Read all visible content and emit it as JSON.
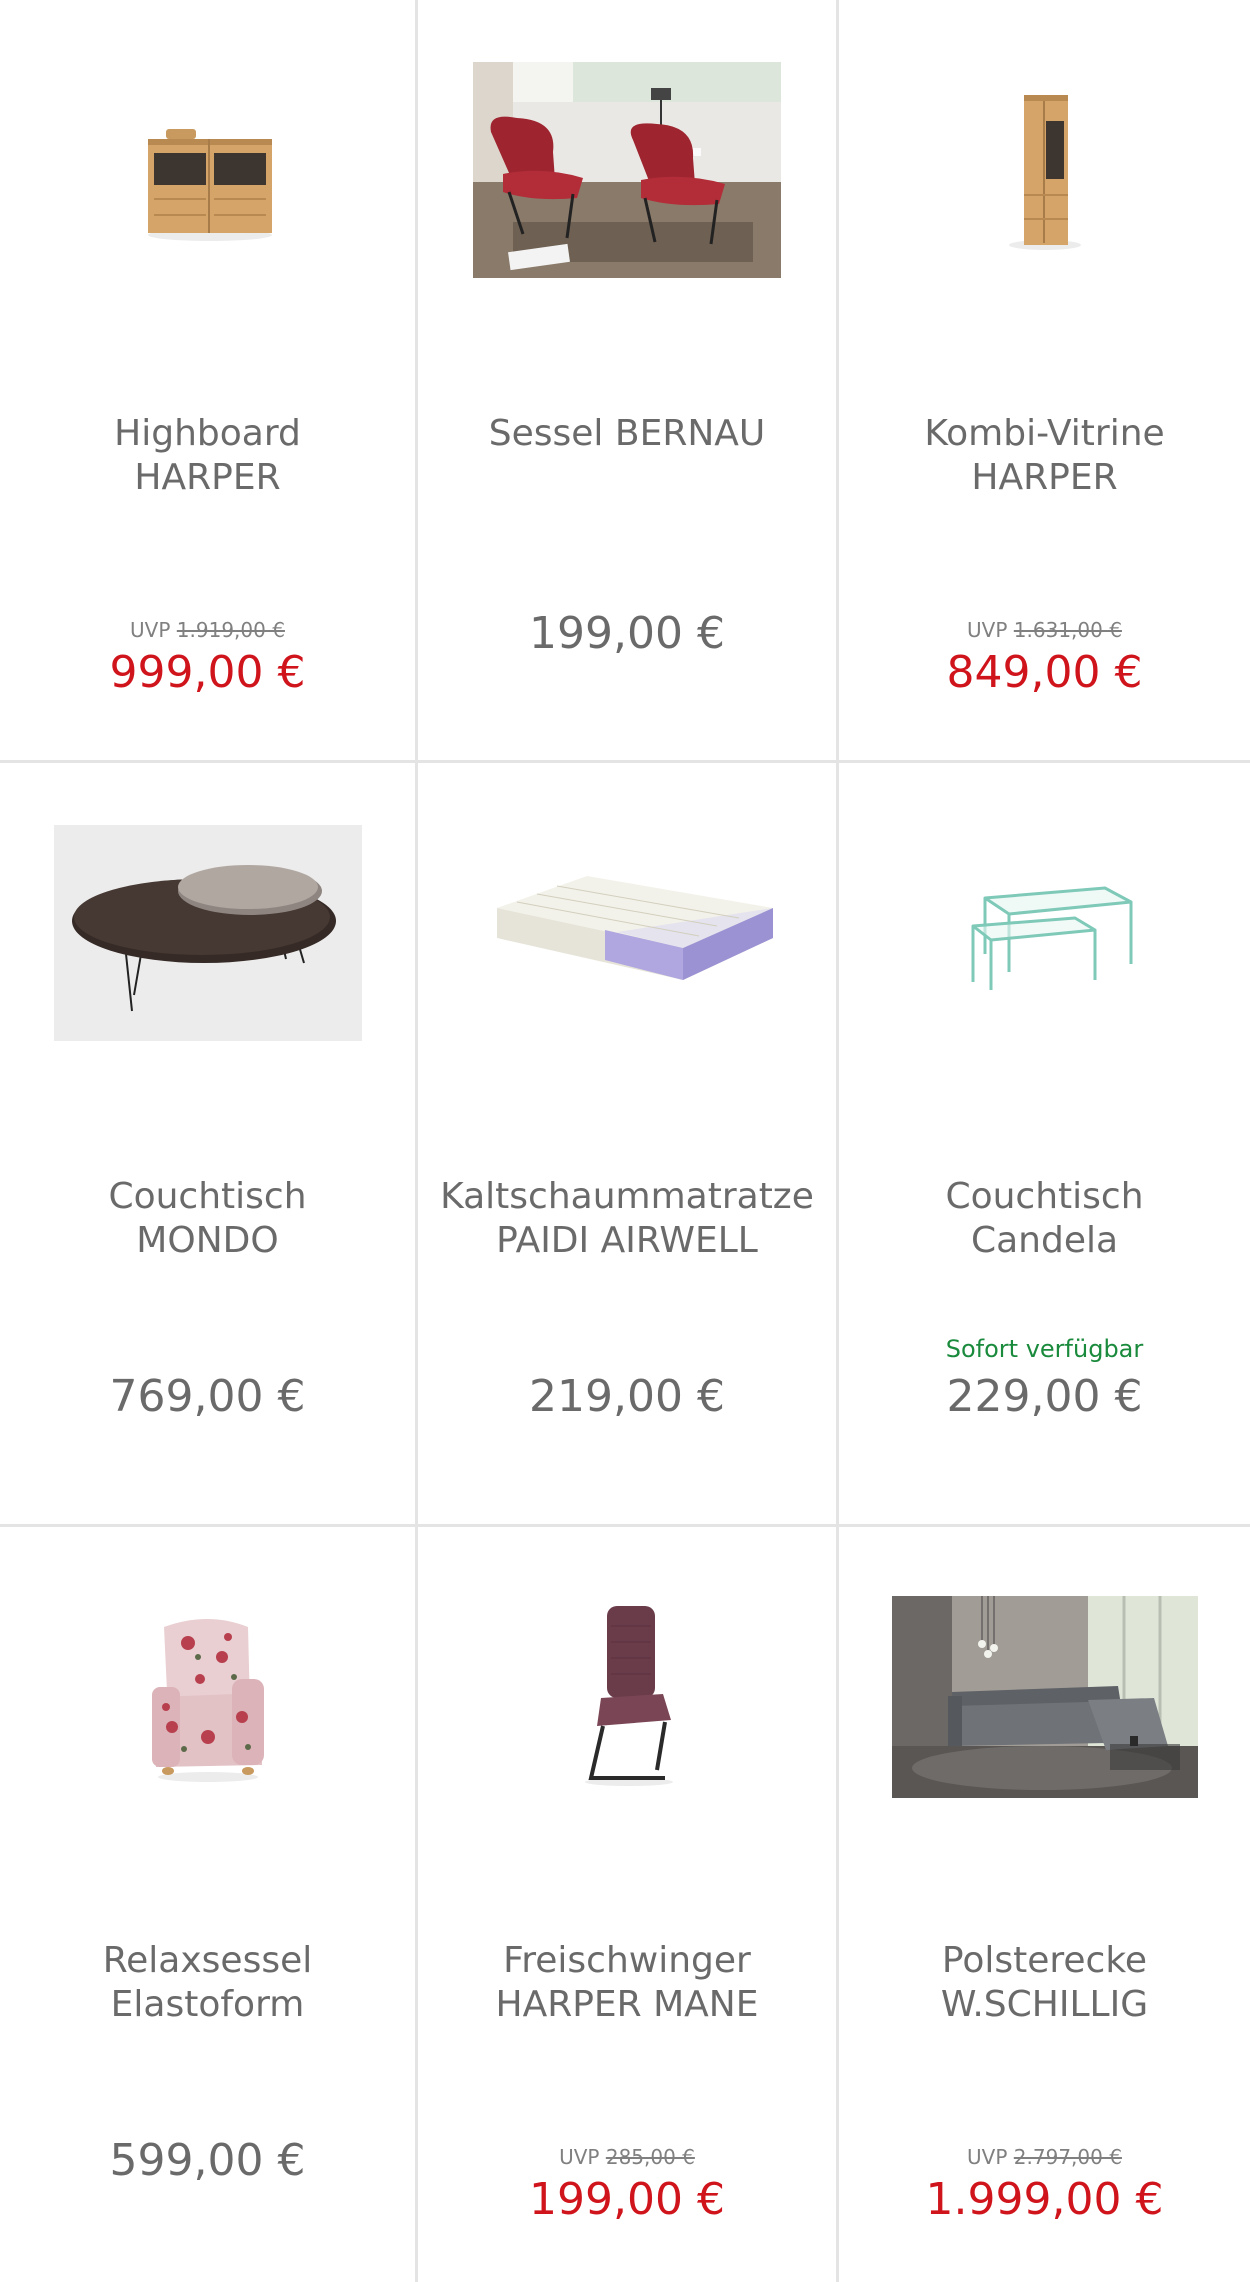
{
  "products": [
    {
      "name": "Highboard\nHARPER",
      "uvp_label": "UVP",
      "uvp": "1.919,00 €",
      "price": "999,00 €",
      "image": "highboard-image"
    },
    {
      "name": "Sessel BERNAU",
      "price": "199,00 €",
      "image": "armchair-pair-image"
    },
    {
      "name": "Kombi-Vitrine\nHARPER",
      "uvp_label": "UVP",
      "uvp": "1.631,00 €",
      "price": "849,00 €",
      "image": "vitrine-image"
    },
    {
      "name": "Couchtisch\nMONDO",
      "price": "769,00 €",
      "image": "oval-coffee-table-image"
    },
    {
      "name": "Kaltschaummatratze\nPAIDI AIRWELL",
      "price": "219,00 €",
      "image": "mattress-image"
    },
    {
      "name": "Couchtisch\nCandela",
      "availability": "Sofort verfügbar",
      "price": "229,00 €",
      "image": "glass-nesting-tables-image"
    },
    {
      "name": "Relaxsessel\nElastoform",
      "price": "599,00 €",
      "image": "floral-armchair-image"
    },
    {
      "name": "Freischwinger\nHARPER MANE",
      "uvp_label": "UVP",
      "uvp": "285,00 €",
      "price": "199,00 €",
      "image": "cantilever-chair-image"
    },
    {
      "name": "Polsterecke\nW.SCHILLIG",
      "uvp_label": "UVP",
      "uvp": "2.797,00 €",
      "price": "1.999,00 €",
      "image": "corner-sofa-image"
    }
  ],
  "colors": {
    "sale_price": "#d0141c",
    "regular_price": "#6a6a6a",
    "availability": "#1a8a3c",
    "divider": "#e4e4e4"
  }
}
